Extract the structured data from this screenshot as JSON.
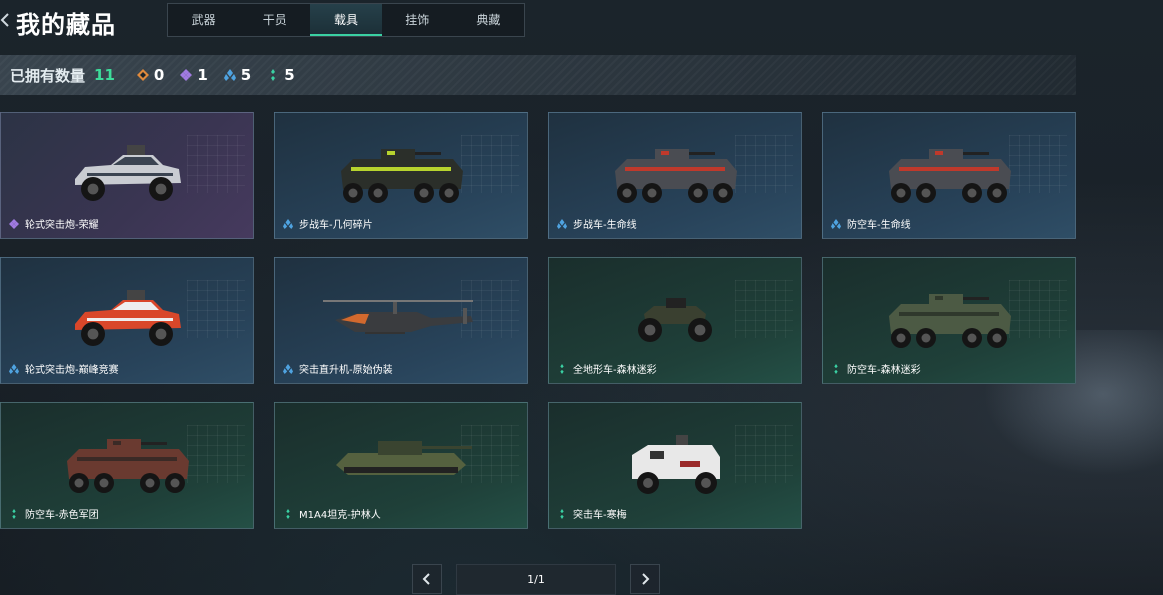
{
  "header": {
    "title": "我的藏品",
    "tabs": [
      {
        "label": "武器",
        "active": false
      },
      {
        "label": "干员",
        "active": false
      },
      {
        "label": "载具",
        "active": true
      },
      {
        "label": "挂饰",
        "active": false
      },
      {
        "label": "典藏",
        "active": false
      }
    ]
  },
  "owned": {
    "label": "已拥有数量",
    "total": "11",
    "rarities": [
      {
        "icon": "orange-rarity-icon",
        "color": "#e08a3c",
        "count": "0"
      },
      {
        "icon": "purple-rarity-icon",
        "color": "#a07ae0",
        "count": "1"
      },
      {
        "icon": "blue-rarity-icon",
        "color": "#4fa3e0",
        "count": "5"
      },
      {
        "icon": "green-rarity-icon",
        "color": "#3ad1a3",
        "count": "5"
      }
    ]
  },
  "items": [
    {
      "name": "轮式突击炮-荣耀",
      "rarity": "purple",
      "vehicle": "buggy",
      "body": "#c9ccd2",
      "accent": "#3b4452"
    },
    {
      "name": "步战车-几何碎片",
      "rarity": "blue",
      "vehicle": "apc",
      "body": "#2b2f2a",
      "accent": "#b7d32e"
    },
    {
      "name": "步战车-生命线",
      "rarity": "blue",
      "vehicle": "apc",
      "body": "#4a4c52",
      "accent": "#c0392b"
    },
    {
      "name": "防空车-生命线",
      "rarity": "blue",
      "vehicle": "apc",
      "body": "#4a4c52",
      "accent": "#c0392b"
    },
    {
      "name": "轮式突击炮-巅峰竞赛",
      "rarity": "blue",
      "vehicle": "buggy",
      "body": "#d9472a",
      "accent": "#eeeeee"
    },
    {
      "name": "突击直升机-原始伪装",
      "rarity": "blue",
      "vehicle": "heli",
      "body": "#3a3c3f",
      "accent": "#d2692e"
    },
    {
      "name": "全地形车-森林迷彩",
      "rarity": "green",
      "vehicle": "atv",
      "body": "#3a4030",
      "accent": "#222222"
    },
    {
      "name": "防空车-森林迷彩",
      "rarity": "green",
      "vehicle": "apc",
      "body": "#4c5a44",
      "accent": "#2f382c"
    },
    {
      "name": "防空车-赤色军团",
      "rarity": "green",
      "vehicle": "apc",
      "body": "#6a3a30",
      "accent": "#3a2a26"
    },
    {
      "name": "M1A4坦克-护林人",
      "rarity": "green",
      "vehicle": "tank",
      "body": "#55613f",
      "accent": "#3a4430"
    },
    {
      "name": "突击车-寒梅",
      "rarity": "green",
      "vehicle": "truck",
      "body": "#e8e8e8",
      "accent": "#9a2a2a"
    }
  ],
  "rarity_colors": {
    "purple": "#a07ae0",
    "blue": "#4fa3e0",
    "green": "#3ad1a3"
  },
  "pagination": {
    "current": "1/1"
  }
}
